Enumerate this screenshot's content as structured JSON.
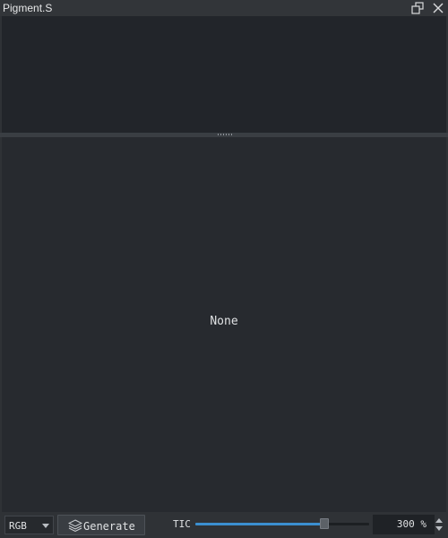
{
  "window": {
    "title": "Pigment.S",
    "float_icon": "float-window-icon",
    "close_icon": "close-icon"
  },
  "main": {
    "placeholder": "None"
  },
  "toolbar": {
    "color_mode": {
      "selected": "RGB"
    },
    "generate_label": "Generate",
    "generate_icon": "layers-icon",
    "tic_label": "TIC",
    "tic_slider_fraction": 0.74,
    "zoom_value": "300 %"
  },
  "colors": {
    "accent": "#3b8fd0",
    "panel_bg": "#272a2f",
    "top_panel_bg": "#22252a",
    "chrome_bg": "#2f3236"
  }
}
